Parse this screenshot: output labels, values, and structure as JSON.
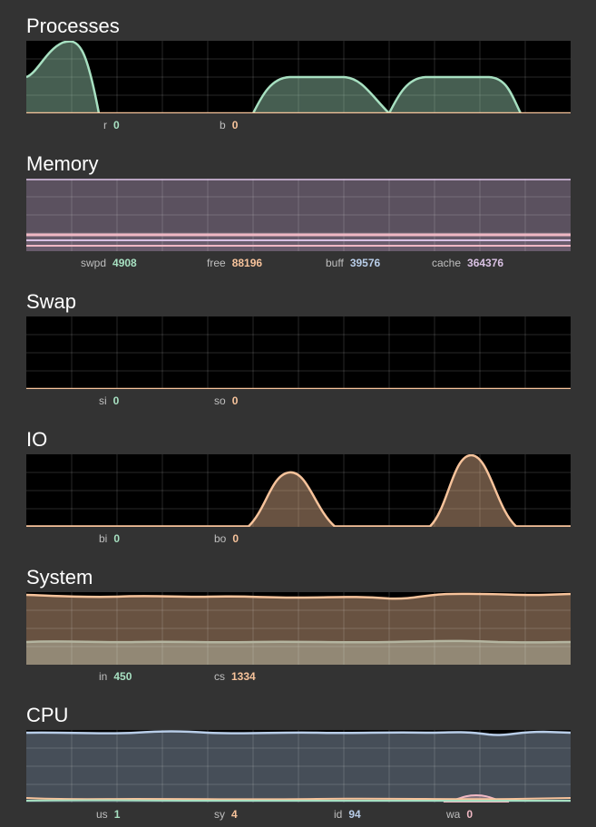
{
  "colors": {
    "background": "#333333",
    "plot_background": "#000000",
    "grid": "#3a3a3a",
    "green": "#a7e0c1",
    "orange": "#f7c39b",
    "lavender": "#d9c1e3",
    "pink": "#f0b8c4",
    "blue": "#b8cde8",
    "olive": "#b4b5a0"
  },
  "panels": [
    {
      "title": "Processes",
      "legend": [
        {
          "label": "r",
          "value": "0",
          "color": "#a7e0c1"
        },
        {
          "label": "b",
          "value": "0",
          "color": "#f7c39b"
        }
      ]
    },
    {
      "title": "Memory",
      "legend": [
        {
          "label": "swpd",
          "value": "4908",
          "color": "#a7e0c1"
        },
        {
          "label": "free",
          "value": "88196",
          "color": "#f7c39b"
        },
        {
          "label": "buff",
          "value": "39576",
          "color": "#b8cde8"
        },
        {
          "label": "cache",
          "value": "364376",
          "color": "#d9c1e3"
        }
      ]
    },
    {
      "title": "Swap",
      "legend": [
        {
          "label": "si",
          "value": "0",
          "color": "#a7e0c1"
        },
        {
          "label": "so",
          "value": "0",
          "color": "#f7c39b"
        }
      ]
    },
    {
      "title": "IO",
      "legend": [
        {
          "label": "bi",
          "value": "0",
          "color": "#a7e0c1"
        },
        {
          "label": "bo",
          "value": "0",
          "color": "#f7c39b"
        }
      ]
    },
    {
      "title": "System",
      "legend": [
        {
          "label": "in",
          "value": "450",
          "color": "#a7e0c1"
        },
        {
          "label": "cs",
          "value": "1334",
          "color": "#f7c39b"
        }
      ]
    },
    {
      "title": "CPU",
      "legend": [
        {
          "label": "us",
          "value": "1",
          "color": "#a7e0c1"
        },
        {
          "label": "sy",
          "value": "4",
          "color": "#f7c39b"
        },
        {
          "label": "id",
          "value": "94",
          "color": "#b8cde8"
        },
        {
          "label": "wa",
          "value": "0",
          "color": "#f0b8c4"
        }
      ]
    }
  ]
}
